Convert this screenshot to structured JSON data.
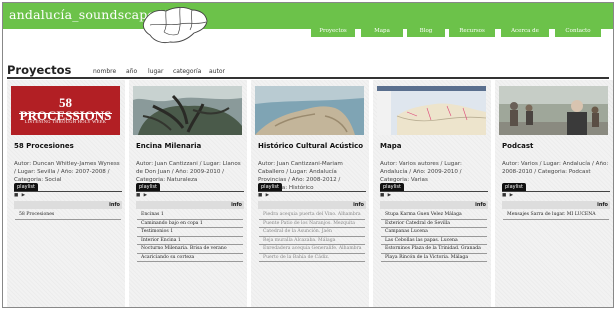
{
  "header": {
    "logo": "andalucía_soundscape )))",
    "nav": [
      "Proyectos",
      "Mapa",
      "Blog",
      "Recursos",
      "Acerca de",
      "Contacto"
    ]
  },
  "section": {
    "title": "Proyectos",
    "sort": [
      "nombre",
      "año",
      "lugar",
      "categoría",
      "autor"
    ]
  },
  "player": {
    "tab": "playlist",
    "info": "info",
    "controls": "■ ▶"
  },
  "projects": [
    {
      "title": "58 Procesiones",
      "image_title": "58 PROCESSIONS",
      "image_sub": "LISTENING THROUGH HOLY WEEK",
      "desc": "Autor: Duncan Whitley-James Wyness / Lugar: Sevilla / Año: 2007-2008 / Categoria: Social",
      "tracks": [
        "58 Procesiones"
      ],
      "dim": false
    },
    {
      "title": "Encina Milenaria",
      "desc": "Autor: Juan Cantizzani / Lugar: Llanos de Don Juan / Año: 2009-2010 / Categoria: Naturaleza",
      "tracks": [
        "Encinas 1",
        "Caminando bajo en copa 1",
        "Testimonios 1",
        "Interior Encina 1",
        "Nocturno Milenaria. Brisa de verano",
        "Acariciando su corteza"
      ],
      "dim": false
    },
    {
      "title": "Histórico Cultural Acústico",
      "desc": "Autor: Juan Cantizzani-Mariam Caballero / Lugar: Andalucía Provincias / Año: 2008-2012 / Categoria: Histórico",
      "tracks": [
        "Piedra acequia puerta del Vino. Alhambra",
        "Puente Patio de los Naranjos. Mezquita",
        "Catedral de la Asunción. Jaén",
        "Reja muralla Alcazaba. Málaga",
        "Enredadera acequia Generalife. Alhambra",
        "Puerto de la Bahía de Cádiz."
      ],
      "dim": true
    },
    {
      "title": "Mapa",
      "desc": "Autor: Varios autores / Lugar: Andalucía / Año: 2009-2010 / Categoria: Varias",
      "tracks": [
        "Stupa Karma Guen Velez Málaga",
        "Exterior Catedral de Sevilla",
        "Campanas Lucena",
        "Las Cebollas las papas. Lucena",
        "Estorninos Plaza de la Trinidad. Granada",
        "Playa Rincón de la Victoria. Málaga"
      ],
      "dim": false
    },
    {
      "title": "Podcast",
      "desc": "Autor: Varios / Lugar: Andalucía / Año: 2008-2010 / Categoria: Podcast",
      "tracks": [
        "Mensajes Sarra de lugar. MI LUCENA"
      ],
      "dim": false
    }
  ]
}
